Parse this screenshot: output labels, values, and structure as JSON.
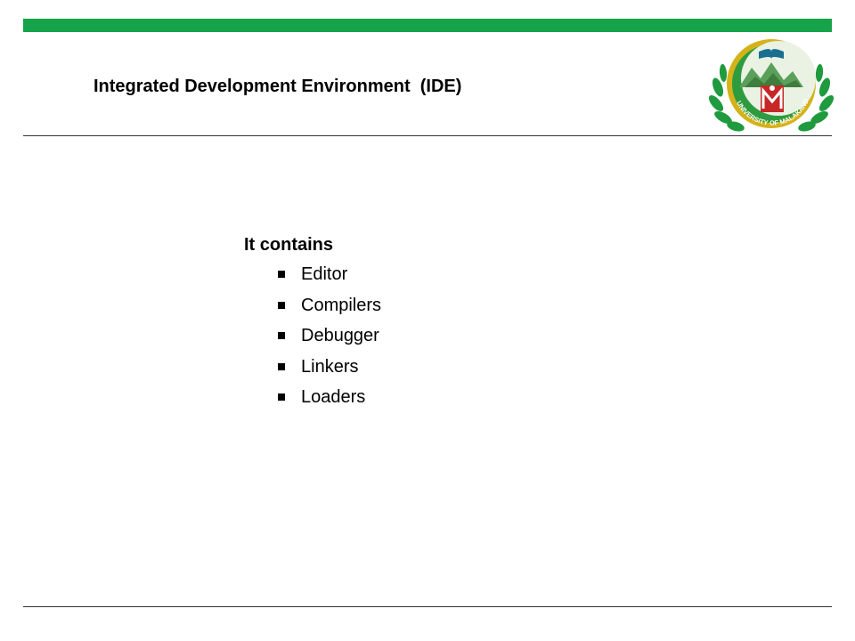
{
  "slide": {
    "title": "Integrated Development Environment  (IDE)",
    "logo_text": "UNIVERSITY OF MALAKAND",
    "intro": "It contains",
    "items": [
      "Editor",
      "Compilers",
      "Debugger",
      "Linkers",
      "Loaders"
    ],
    "bullet_icon": "square-bullet-icon"
  },
  "colors": {
    "accent_bar": "#17a34a",
    "logo_green": "#1f9a3e",
    "logo_gold": "#d4b21a",
    "logo_red": "#c62828"
  }
}
